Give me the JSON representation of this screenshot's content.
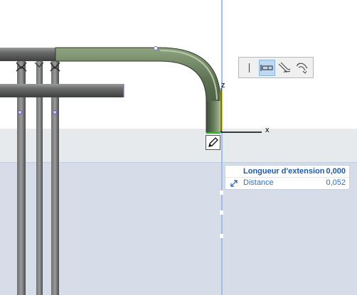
{
  "axes": {
    "z_label": "z",
    "x_label": "x"
  },
  "snap_palette": {
    "buttons": [
      {
        "icon": "vertical-line-icon",
        "active": false
      },
      {
        "icon": "straight-extend-icon",
        "active": true
      },
      {
        "icon": "bend-extend-icon",
        "active": false
      },
      {
        "icon": "double-bend-extend-icon",
        "active": false
      }
    ]
  },
  "tracker": {
    "rows": [
      {
        "label": "Longueur d'extension",
        "value": "0,000"
      },
      {
        "label": "Distance",
        "value": "0,052",
        "icon": "distance-arrow-icon"
      }
    ]
  },
  "colors": {
    "selected_pipe": "#5c7050",
    "pipe": "#5f6060",
    "guide": "#9fbde6",
    "tracker_text": "#1c5aa8",
    "active_button": "#bdd8f0"
  }
}
